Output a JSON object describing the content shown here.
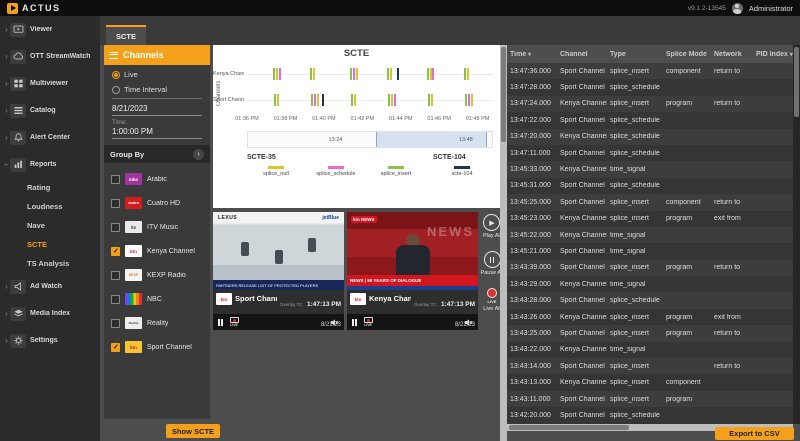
{
  "topbar": {
    "brand": "ACTUS",
    "version": "v9.1.2-13545",
    "user": "Administrator"
  },
  "tab": "SCTE",
  "sidebar": {
    "items": [
      {
        "label": "Viewer",
        "icon": "viewer"
      },
      {
        "label": "OTT StreamWatch",
        "icon": "cloud"
      },
      {
        "label": "Multiviewer",
        "icon": "multiviewer"
      },
      {
        "label": "Catalog",
        "icon": "catalog"
      },
      {
        "label": "Alert Center",
        "icon": "bell"
      },
      {
        "label": "Reports",
        "icon": "reports",
        "expanded": true,
        "children": [
          {
            "label": "Rating"
          },
          {
            "label": "Loudness"
          },
          {
            "label": "Nave"
          },
          {
            "label": "SCTE",
            "active": true
          },
          {
            "label": "TS Analysis"
          }
        ]
      },
      {
        "label": "Ad Watch",
        "icon": "adwatch"
      },
      {
        "label": "Media Index",
        "icon": "media"
      },
      {
        "label": "Settings",
        "icon": "gear"
      }
    ]
  },
  "channels_panel": {
    "title": "Channels",
    "mode_live": "Live",
    "mode_interval": "Time Interval",
    "date_value": "8/21/2023",
    "time_label": "Time:",
    "time_value": "1:00:00 PM",
    "group_by": "Group By",
    "channels": [
      {
        "name": "Arabic",
        "checked": false,
        "logo_text": "mbc",
        "logo_bg": "#a0359f",
        "logo_fg": "#ffffff",
        "logo_fs": 4.5
      },
      {
        "name": "Cuatro HD",
        "checked": false,
        "logo_text": "cuatro",
        "logo_bg": "#d21d1d",
        "logo_fg": "#ffffff",
        "logo_fs": 3.5
      },
      {
        "name": "ITV Music",
        "checked": false,
        "logo_text": "itv",
        "logo_bg": "#e9e9e9",
        "logo_fg": "#333333",
        "logo_fs": 4.5
      },
      {
        "name": "Kenya Channel",
        "checked": true,
        "logo_text": "ktn",
        "logo_bg": "#ffffff",
        "logo_fg": "#d21d1d",
        "logo_fs": 4.5
      },
      {
        "name": "KEXP Radio",
        "checked": false,
        "logo_text": "KEXP",
        "logo_bg": "#f4f4f4",
        "logo_fg": "#e87722",
        "logo_fs": 3.5
      },
      {
        "name": "NBC",
        "checked": false,
        "logo_text": "",
        "logo_bg": "peacock",
        "logo_fg": "#333333",
        "logo_fs": 4
      },
      {
        "name": "Reality",
        "checked": false,
        "logo_text": "Reality",
        "logo_bg": "#ececec",
        "logo_fg": "#444444",
        "logo_fs": 3
      },
      {
        "name": "Sport Channel",
        "checked": true,
        "logo_text": "ktn",
        "logo_bg": "#f8c437",
        "logo_fg": "#d21d1d",
        "logo_fs": 4.5
      }
    ],
    "show_scte": "Show SCTE"
  },
  "chart_data": {
    "type": "event-timeline",
    "title": "SCTE",
    "ylabel": "Channels",
    "channels": [
      "Kenya Channel",
      "Sport Channel"
    ],
    "x_ticks": [
      "01:36 PM",
      "01:38 PM",
      "01:40 PM",
      "01:42 PM",
      "01:44 PM",
      "01:46 PM",
      "01:48 PM"
    ],
    "x_range_minutes": 12.8,
    "brush": {
      "labels": [
        "13:24",
        "13:48"
      ],
      "label_pos": [
        0.36,
        0.89
      ],
      "selection": [
        0.52,
        0.97
      ]
    },
    "legend": {
      "scte35_title": "SCTE-35",
      "scte104_title": "SCTE-104",
      "entries": [
        {
          "key": "splice_null",
          "label": "splice_null",
          "color": "#d9c62f"
        },
        {
          "key": "splice_schedule",
          "label": "splice_schedule",
          "color": "#e36ad8"
        },
        {
          "key": "splice_insert",
          "label": "splice_insert",
          "color": "#8bc34a"
        },
        {
          "key": "scte104",
          "label": "scte-104",
          "color": "#1f3554"
        }
      ]
    },
    "events": [
      {
        "c": 0,
        "t": 1.35,
        "k": "splice_insert"
      },
      {
        "c": 0,
        "t": 1.5,
        "k": "splice_null"
      },
      {
        "c": 0,
        "t": 1.65,
        "k": "splice_schedule"
      },
      {
        "c": 0,
        "t": 3.3,
        "k": "splice_insert"
      },
      {
        "c": 0,
        "t": 3.45,
        "k": "splice_null"
      },
      {
        "c": 0,
        "t": 5.35,
        "k": "splice_insert"
      },
      {
        "c": 0,
        "t": 5.5,
        "k": "splice_schedule"
      },
      {
        "c": 0,
        "t": 5.65,
        "k": "splice_null"
      },
      {
        "c": 0,
        "t": 7.3,
        "k": "splice_insert"
      },
      {
        "c": 0,
        "t": 7.45,
        "k": "splice_null"
      },
      {
        "c": 0,
        "t": 7.8,
        "k": "scte104"
      },
      {
        "c": 0,
        "t": 9.35,
        "k": "splice_insert"
      },
      {
        "c": 0,
        "t": 9.5,
        "k": "splice_null"
      },
      {
        "c": 0,
        "t": 9.65,
        "k": "splice_schedule"
      },
      {
        "c": 0,
        "t": 11.3,
        "k": "splice_insert"
      },
      {
        "c": 0,
        "t": 11.45,
        "k": "splice_null"
      },
      {
        "c": 1,
        "t": 1.4,
        "k": "splice_insert"
      },
      {
        "c": 1,
        "t": 1.55,
        "k": "splice_null"
      },
      {
        "c": 1,
        "t": 3.35,
        "k": "splice_insert"
      },
      {
        "c": 1,
        "t": 3.5,
        "k": "splice_schedule"
      },
      {
        "c": 1,
        "t": 3.65,
        "k": "splice_null"
      },
      {
        "c": 1,
        "t": 3.9,
        "k": "scte104"
      },
      {
        "c": 1,
        "t": 5.4,
        "k": "splice_insert"
      },
      {
        "c": 1,
        "t": 5.55,
        "k": "splice_null"
      },
      {
        "c": 1,
        "t": 7.35,
        "k": "splice_insert"
      },
      {
        "c": 1,
        "t": 7.5,
        "k": "splice_null"
      },
      {
        "c": 1,
        "t": 7.65,
        "k": "splice_schedule"
      },
      {
        "c": 1,
        "t": 9.4,
        "k": "splice_insert"
      },
      {
        "c": 1,
        "t": 9.55,
        "k": "splice_null"
      },
      {
        "c": 1,
        "t": 11.35,
        "k": "splice_insert"
      },
      {
        "c": 1,
        "t": 11.5,
        "k": "splice_schedule"
      },
      {
        "c": 1,
        "t": 11.65,
        "k": "splice_null"
      }
    ]
  },
  "players": {
    "cards": [
      {
        "name": "Sport Channel",
        "logo_text": "ktn",
        "overlay_label": "Overlay TC",
        "time": "1:47:13 PM",
        "date": "8/21/23",
        "ad_left": "LEXUS",
        "ad_right": "jetBlue",
        "ticker": "PARTNERS RELEASE LIST OF PROTECTED PLAYERS"
      },
      {
        "name": "Kenya Channe",
        "logo_text": "ktn",
        "overlay_label": "Overlay TC",
        "time": "1:47:13 PM",
        "date": "8/21/23",
        "watermark": "NEWS",
        "corner_logo": "ktn NEWS",
        "ticker": "NEWS  |  50 YEARS OF DIALOGUE"
      }
    ],
    "live_badge": "LIVE",
    "play_all": "Play All",
    "pause_all": "Pause All",
    "live_all": "Live All"
  },
  "table": {
    "columns": [
      "Time",
      "Channel",
      "Type",
      "Splice Mode",
      "Network",
      "PID Index"
    ],
    "sorted_columns": [
      0,
      5
    ],
    "rows": [
      [
        "13:47:36.000",
        "Sport Channel",
        "splice_insert",
        "component",
        "return to",
        ""
      ],
      [
        "13:47:28.000",
        "Sport Channel",
        "splice_schedule",
        "",
        "",
        ""
      ],
      [
        "13:47:24.000",
        "Kenya Channel",
        "splice_insert",
        "program",
        "return to",
        ""
      ],
      [
        "13:47:22.000",
        "Sport Channel",
        "splice_schedule",
        "",
        "",
        ""
      ],
      [
        "13:47:20.000",
        "Kenya Channel",
        "splice_schedule",
        "",
        "",
        ""
      ],
      [
        "13:47:11.000",
        "Sport Channel",
        "splice_schedule",
        "",
        "",
        ""
      ],
      [
        "13:45:33.000",
        "Kenya Channel",
        "time_signal",
        "",
        "",
        ""
      ],
      [
        "13:45:31.000",
        "Sport Channel",
        "splice_schedule",
        "",
        "",
        ""
      ],
      [
        "13:45:25.000",
        "Sport Channel",
        "splice_insert",
        "component",
        "return to",
        ""
      ],
      [
        "13:45:23.000",
        "Kenya Channel",
        "splice_insert",
        "program",
        "exit from",
        ""
      ],
      [
        "13:45:22.000",
        "Kenya Channel",
        "time_signal",
        "",
        "",
        ""
      ],
      [
        "13:45:21.000",
        "Sport Channel",
        "time_signal",
        "",
        "",
        ""
      ],
      [
        "13:43:39.000",
        "Sport Channel",
        "splice_insert",
        "program",
        "return to",
        ""
      ],
      [
        "13:43:29.000",
        "Kenya Channel",
        "time_signal",
        "",
        "",
        ""
      ],
      [
        "13:43:28.000",
        "Sport Channel",
        "splice_schedule",
        "",
        "",
        ""
      ],
      [
        "13:43:26.000",
        "Kenya Channel",
        "splice_insert",
        "program",
        "exit from",
        ""
      ],
      [
        "13:43:25.000",
        "Sport Channel",
        "splice_insert",
        "program",
        "return to",
        ""
      ],
      [
        "13:43:22.000",
        "Kenya Channel",
        "time_signal",
        "",
        "",
        ""
      ],
      [
        "13:43:14.000",
        "Sport Channel",
        "splice_insert",
        "",
        "return to",
        ""
      ],
      [
        "13:43:13.000",
        "Kenya Channel",
        "splice_insert",
        "component",
        "",
        ""
      ],
      [
        "13:43:11.000",
        "Sport Channel",
        "splice_insert",
        "program",
        "",
        ""
      ],
      [
        "13:42:20.000",
        "Sport Channel",
        "splice_schedule",
        "",
        "",
        ""
      ]
    ],
    "export_csv": "Export to CSV"
  }
}
